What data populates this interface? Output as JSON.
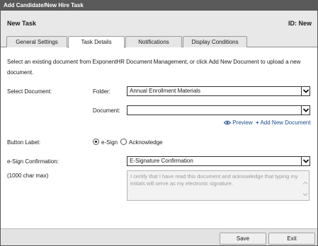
{
  "titlebar": {
    "title": "Add Candidate/New Hire Task"
  },
  "header": {
    "title": "New Task",
    "id_label": "ID: New"
  },
  "tabs": [
    {
      "label": "General Settings"
    },
    {
      "label": "Task Details"
    },
    {
      "label": "Notifications"
    },
    {
      "label": "Display Conditions"
    }
  ],
  "form": {
    "instructions_line1": "Select an existing document from ExponentHR Document Management, or click Add New Document to upload a new",
    "instructions_line2": "document.",
    "select_document_label": "Select Document:",
    "folder_label": "Folder:",
    "folder_value": "Annual Enrollment Materials",
    "document_label": "Document:",
    "document_value": "",
    "preview_label": "Preview",
    "add_new_label": "Add New Document",
    "button_label_label": "Button Label:",
    "esign_option": "e-Sign",
    "acknowledge_option": "Acknowledge",
    "esign_confirmation_label": "e-Sign Confirmation:",
    "esign_confirmation_value": "E-Signature Confirmation",
    "char_max_label": "(1000 char max)",
    "confirmation_text": "I certify that I have read this document and acknowledge that typing my initials will serve as my electronic signature."
  },
  "footer": {
    "save_label": "Save",
    "exit_label": "Exit"
  },
  "icons": {
    "preview": "eye-icon",
    "add": "plus-icon",
    "dropdown": "chevron-down-icon"
  }
}
